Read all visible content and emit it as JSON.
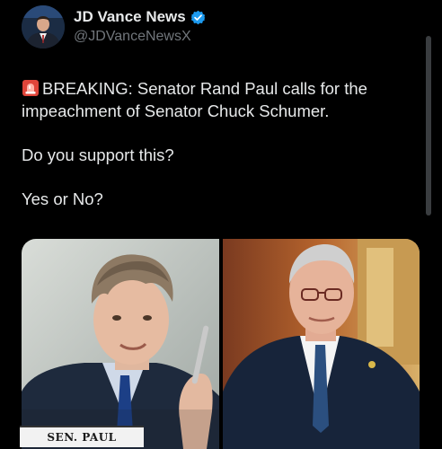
{
  "author": {
    "display_name": "JD Vance News",
    "handle": "@JDVanceNewsX",
    "verified": true,
    "verified_color": "#1d9bf0"
  },
  "tweet": {
    "emoji": "rotating-light-icon",
    "headline": "BREAKING: Senator Rand Paul calls for the impeachment of Senator Chuck Schumer.",
    "question": "Do you support this?",
    "prompt": "Yes or No?"
  },
  "media": {
    "left_nameplate": "SEN. PAUL"
  },
  "colors": {
    "background": "#000000",
    "text_primary": "#e7e9ea",
    "text_secondary": "#71767b"
  }
}
